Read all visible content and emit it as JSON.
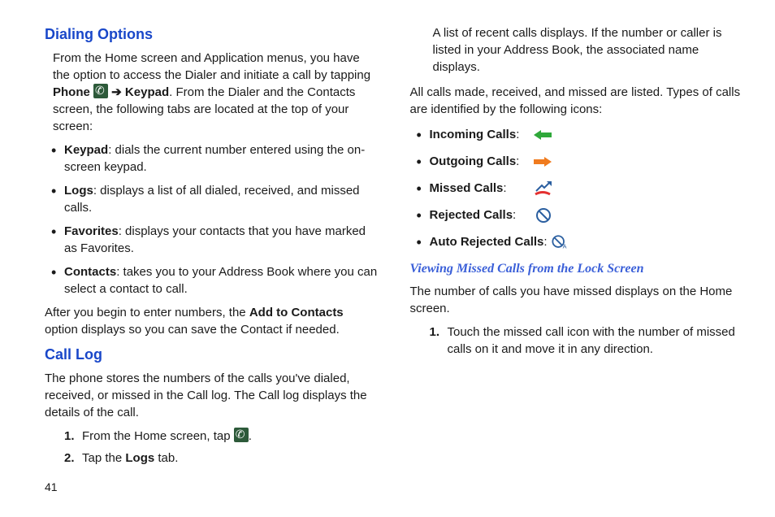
{
  "page_number": "41",
  "left": {
    "h_dialing": "Dialing Options",
    "dialing_intro_a": "From the Home screen and Application menus, you have the option to access the Dialer and initiate a call by tapping ",
    "dialing_phone": "Phone",
    "dialing_arrow": " ➔ ",
    "dialing_keypad": "Keypad",
    "dialing_intro_b": ". From the Dialer and the Contacts screen, the following tabs are located at the top of your screen:",
    "b1_key": "Keypad",
    "b1_txt": ": dials the current number entered using the on-screen keypad.",
    "b2_key": "Logs",
    "b2_txt": ": displays a list of all dialed, received, and missed calls.",
    "b3_key": "Favorites",
    "b3_txt": ": displays your contacts that you have marked as Favorites.",
    "b4_key": "Contacts",
    "b4_txt": ": takes you to your Address Book where you can select a contact to call.",
    "after_a": "After you begin to enter numbers, the ",
    "after_b": "Add to Contacts",
    "after_c": " option displays so you can save the Contact if needed.",
    "h_calllog": "Call Log",
    "calllog_intro": "The phone stores the numbers of the calls you've dialed, received, or missed in the Call log. The Call log displays the details of the call.",
    "step1_n": "1.",
    "step1_a": "From the Home screen, tap ",
    "step1_b": ".",
    "step2_n": "2.",
    "step2_a": "Tap the ",
    "step2_b": "Logs",
    "step2_c": " tab."
  },
  "right": {
    "cont": "A list of recent calls displays. If the number or caller is listed in your Address Book, the associated name displays.",
    "all_calls": "All calls made, received, and missed are listed. Types of calls are identified by the following icons:",
    "ic1": "Incoming Calls",
    "ic2": "Outgoing Calls",
    "ic3": "Missed Calls",
    "ic4": "Rejected Calls",
    "ic5": "Auto Rejected Calls",
    "colon": ":",
    "h_viewing": "Viewing Missed Calls from the Lock Screen",
    "viewing_intro": "The number of calls you have missed displays on the Home screen.",
    "vstep1_n": "1.",
    "vstep1": "Touch the missed call icon with the number of missed calls on it and move it in any direction."
  }
}
